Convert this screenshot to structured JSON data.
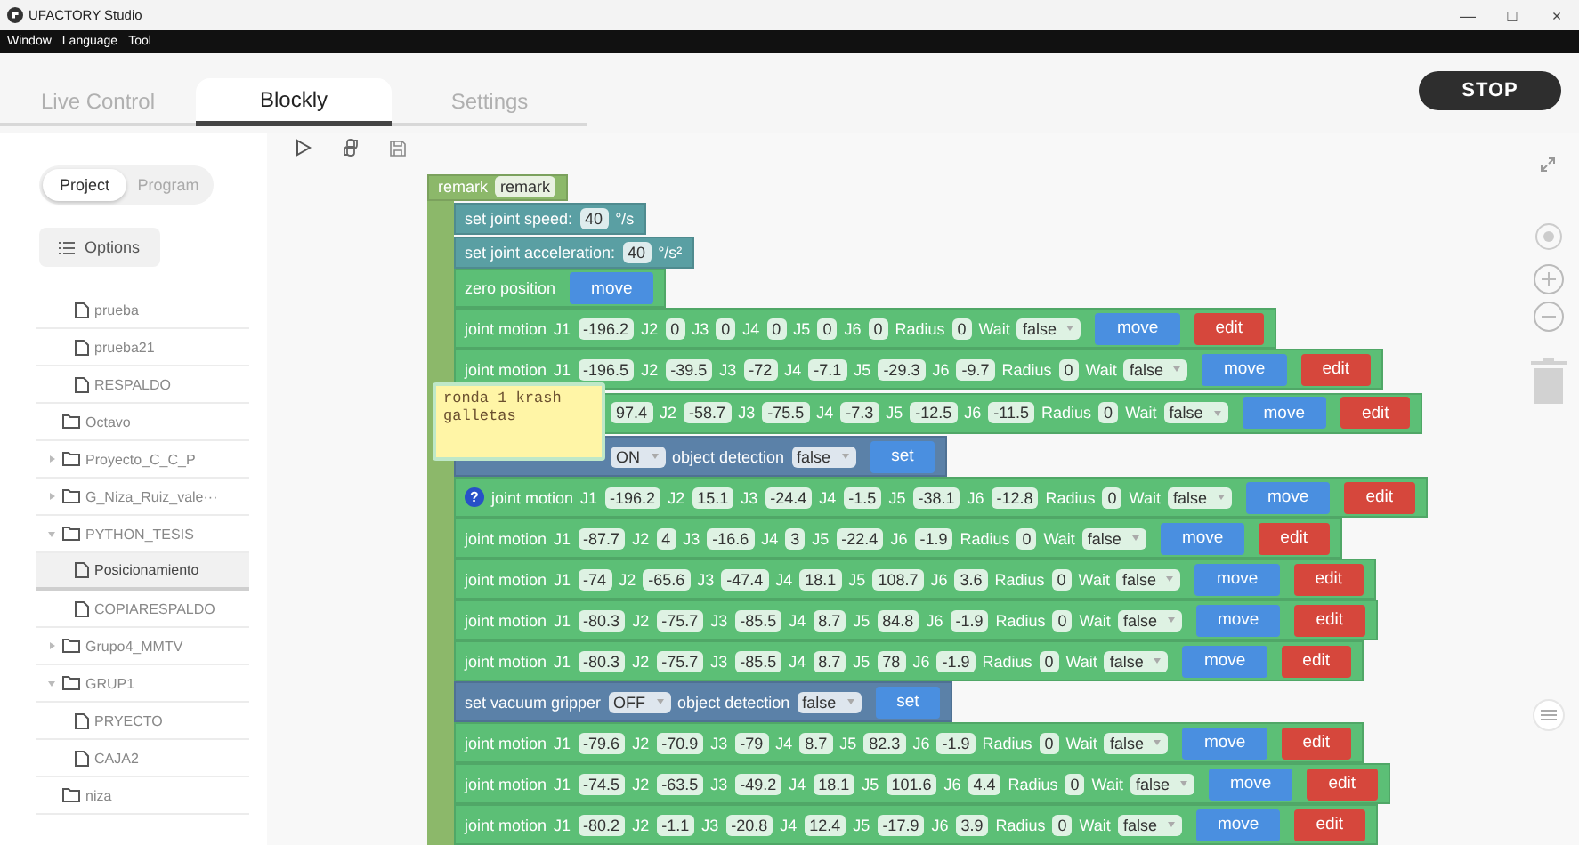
{
  "window": {
    "title": "UFACTORY Studio",
    "controls": [
      "—",
      "□",
      "×"
    ]
  },
  "menu": [
    "Window",
    "Language",
    "Tool"
  ],
  "tabs": [
    {
      "label": "Live Control",
      "selected": false
    },
    {
      "label": "Blockly",
      "selected": true
    },
    {
      "label": "Settings",
      "selected": false
    }
  ],
  "stop_button": "STOP",
  "sidebar": {
    "toggle": [
      {
        "label": "Project",
        "selected": true
      },
      {
        "label": "Program",
        "selected": false
      }
    ],
    "options_button": "Options",
    "tree": [
      {
        "children": [
          {
            "kind": "file",
            "label": "prueba",
            "selected": false
          },
          {
            "kind": "file",
            "label": "prueba21",
            "selected": false
          },
          {
            "kind": "file",
            "label": "RESPALDO",
            "selected": false
          }
        ]
      },
      {
        "kind": "empty-folder",
        "label": "Octavo",
        "selected": false
      },
      {
        "kind": "folder",
        "label": "Proyecto_C_C_P",
        "expanded": false,
        "selected": false
      },
      {
        "kind": "folder",
        "label": "G_Niza_Ruiz_vale···",
        "expanded": false,
        "selected": false
      },
      {
        "kind": "folder",
        "label": "PYTHON_TESIS",
        "expanded": true,
        "selected": false,
        "children": [
          {
            "kind": "file",
            "label": "Posicionamiento",
            "selected": true
          },
          {
            "kind": "file",
            "label": "COPIARESPALDO",
            "selected": false
          }
        ]
      },
      {
        "kind": "folder",
        "label": "Grupo4_MMTV",
        "expanded": false,
        "selected": false
      },
      {
        "kind": "folder",
        "label": "GRUP1",
        "expanded": true,
        "selected": false,
        "children": [
          {
            "kind": "file",
            "label": "PRYECTO",
            "selected": false
          },
          {
            "kind": "file",
            "label": "CAJA2",
            "selected": false
          }
        ]
      },
      {
        "kind": "empty-folder",
        "label": "niza",
        "selected": false
      }
    ]
  },
  "workspace": {
    "comment": "ronda 1 krash\ngalletas",
    "blocks": [
      {
        "kind": "remark",
        "label": "remark",
        "params": [
          {
            "value": "remark"
          }
        ],
        "children": [
          {
            "kind": "speed",
            "label": "set joint speed:",
            "params": [
              {
                "value": "40",
                "unit": "°/s"
              }
            ]
          },
          {
            "kind": "speed",
            "label": "set joint acceleration:",
            "params": [
              {
                "value": "40",
                "unit": "°/s²"
              }
            ]
          },
          {
            "kind": "zero",
            "label": "zero position",
            "actions": [
              {
                "text": "move",
                "color": "#4a8fe0"
              }
            ]
          },
          {
            "kind": "joint",
            "label": "joint motion",
            "params": [
              {
                "name": "J1",
                "value": "-196.2"
              },
              {
                "name": "J2",
                "value": "0"
              },
              {
                "name": "J3",
                "value": "0"
              },
              {
                "name": "J4",
                "value": "0"
              },
              {
                "name": "J5",
                "value": "0"
              },
              {
                "name": "J6",
                "value": "0"
              },
              {
                "name": "Radius",
                "value": "0"
              },
              {
                "name": "Wait",
                "dropdown": "false"
              }
            ],
            "actions": [
              {
                "text": "move",
                "color": "#4a8fe0"
              },
              {
                "text": "edit",
                "color": "#d6473c"
              }
            ]
          },
          {
            "kind": "joint",
            "label": "joint motion",
            "params": [
              {
                "name": "J1",
                "value": "-196.5"
              },
              {
                "name": "J2",
                "value": "-39.5"
              },
              {
                "name": "J3",
                "value": "-72"
              },
              {
                "name": "J4",
                "value": "-7.1"
              },
              {
                "name": "J5",
                "value": "-29.3"
              },
              {
                "name": "J6",
                "value": "-9.7"
              },
              {
                "name": "Radius",
                "value": "0"
              },
              {
                "name": "Wait",
                "dropdown": "false"
              }
            ],
            "actions": [
              {
                "text": "move",
                "color": "#4a8fe0"
              },
              {
                "text": "edit",
                "color": "#d6473c"
              }
            ]
          },
          {
            "kind": "joint",
            "params": [
              {
                "value": "97.4"
              },
              {
                "name": "J2",
                "value": "-58.7"
              },
              {
                "name": "J3",
                "value": "-75.5"
              },
              {
                "name": "J4",
                "value": "-7.3"
              },
              {
                "name": "J5",
                "value": "-12.5"
              },
              {
                "name": "J6",
                "value": "-11.5"
              },
              {
                "name": "Radius",
                "value": "0"
              },
              {
                "name": "Wait",
                "dropdown": "false"
              }
            ],
            "actions": [
              {
                "text": "move",
                "color": "#4a8fe0"
              },
              {
                "text": "edit",
                "color": "#d6473c"
              }
            ]
          },
          {
            "kind": "gripper",
            "params": [
              {
                "dropdown": "ON"
              },
              {
                "name": "object detection",
                "dropdown": "false"
              }
            ],
            "actions": [
              {
                "text": "set",
                "color": "#4a8fe0"
              }
            ]
          },
          {
            "kind": "joint",
            "help": "?",
            "label": "joint motion",
            "params": [
              {
                "name": "J1",
                "value": "-196.2"
              },
              {
                "name": "J2",
                "value": "15.1"
              },
              {
                "name": "J3",
                "value": "-24.4"
              },
              {
                "name": "J4",
                "value": "-1.5"
              },
              {
                "name": "J5",
                "value": "-38.1"
              },
              {
                "name": "J6",
                "value": "-12.8"
              },
              {
                "name": "Radius",
                "value": "0"
              },
              {
                "name": "Wait",
                "dropdown": "false"
              }
            ],
            "actions": [
              {
                "text": "move",
                "color": "#4a8fe0"
              },
              {
                "text": "edit",
                "color": "#d6473c"
              }
            ]
          },
          {
            "kind": "joint",
            "label": "joint motion",
            "params": [
              {
                "name": "J1",
                "value": "-87.7"
              },
              {
                "name": "J2",
                "value": "4"
              },
              {
                "name": "J3",
                "value": "-16.6"
              },
              {
                "name": "J4",
                "value": "3"
              },
              {
                "name": "J5",
                "value": "-22.4"
              },
              {
                "name": "J6",
                "value": "-1.9"
              },
              {
                "name": "Radius",
                "value": "0"
              },
              {
                "name": "Wait",
                "dropdown": "false"
              }
            ],
            "actions": [
              {
                "text": "move",
                "color": "#4a8fe0"
              },
              {
                "text": "edit",
                "color": "#d6473c"
              }
            ]
          },
          {
            "kind": "joint",
            "label": "joint motion",
            "params": [
              {
                "name": "J1",
                "value": "-74"
              },
              {
                "name": "J2",
                "value": "-65.6"
              },
              {
                "name": "J3",
                "value": "-47.4"
              },
              {
                "name": "J4",
                "value": "18.1"
              },
              {
                "name": "J5",
                "value": "108.7"
              },
              {
                "name": "J6",
                "value": "3.6"
              },
              {
                "name": "Radius",
                "value": "0"
              },
              {
                "name": "Wait",
                "dropdown": "false"
              }
            ],
            "actions": [
              {
                "text": "move",
                "color": "#4a8fe0"
              },
              {
                "text": "edit",
                "color": "#d6473c"
              }
            ]
          },
          {
            "kind": "joint",
            "label": "joint motion",
            "params": [
              {
                "name": "J1",
                "value": "-80.3"
              },
              {
                "name": "J2",
                "value": "-75.7"
              },
              {
                "name": "J3",
                "value": "-85.5"
              },
              {
                "name": "J4",
                "value": "8.7"
              },
              {
                "name": "J5",
                "value": "84.8"
              },
              {
                "name": "J6",
                "value": "-1.9"
              },
              {
                "name": "Radius",
                "value": "0"
              },
              {
                "name": "Wait",
                "dropdown": "false"
              }
            ],
            "actions": [
              {
                "text": "move",
                "color": "#4a8fe0"
              },
              {
                "text": "edit",
                "color": "#d6473c"
              }
            ]
          },
          {
            "kind": "joint",
            "label": "joint motion",
            "params": [
              {
                "name": "J1",
                "value": "-80.3"
              },
              {
                "name": "J2",
                "value": "-75.7"
              },
              {
                "name": "J3",
                "value": "-85.5"
              },
              {
                "name": "J4",
                "value": "8.7"
              },
              {
                "name": "J5",
                "value": "78"
              },
              {
                "name": "J6",
                "value": "-1.9"
              },
              {
                "name": "Radius",
                "value": "0"
              },
              {
                "name": "Wait",
                "dropdown": "false"
              }
            ],
            "actions": [
              {
                "text": "move",
                "color": "#4a8fe0"
              },
              {
                "text": "edit",
                "color": "#d6473c"
              }
            ]
          },
          {
            "kind": "gripper",
            "label": "set vacuum gripper",
            "params": [
              {
                "dropdown": "OFF"
              },
              {
                "name": "object detection",
                "dropdown": "false"
              }
            ],
            "actions": [
              {
                "text": "set",
                "color": "#4a8fe0"
              }
            ]
          },
          {
            "kind": "joint",
            "label": "joint motion",
            "params": [
              {
                "name": "J1",
                "value": "-79.6"
              },
              {
                "name": "J2",
                "value": "-70.9"
              },
              {
                "name": "J3",
                "value": "-79"
              },
              {
                "name": "J4",
                "value": "8.7"
              },
              {
                "name": "J5",
                "value": "82.3"
              },
              {
                "name": "J6",
                "value": "-1.9"
              },
              {
                "name": "Radius",
                "value": "0"
              },
              {
                "name": "Wait",
                "dropdown": "false"
              }
            ],
            "actions": [
              {
                "text": "move",
                "color": "#4a8fe0"
              },
              {
                "text": "edit",
                "color": "#d6473c"
              }
            ]
          },
          {
            "kind": "joint",
            "label": "joint motion",
            "params": [
              {
                "name": "J1",
                "value": "-74.5"
              },
              {
                "name": "J2",
                "value": "-63.5"
              },
              {
                "name": "J3",
                "value": "-49.2"
              },
              {
                "name": "J4",
                "value": "18.1"
              },
              {
                "name": "J5",
                "value": "101.6"
              },
              {
                "name": "J6",
                "value": "4.4"
              },
              {
                "name": "Radius",
                "value": "0"
              },
              {
                "name": "Wait",
                "dropdown": "false"
              }
            ],
            "actions": [
              {
                "text": "move",
                "color": "#4a8fe0"
              },
              {
                "text": "edit",
                "color": "#d6473c"
              }
            ]
          },
          {
            "kind": "joint",
            "label": "joint motion",
            "params": [
              {
                "name": "J1",
                "value": "-80.2"
              },
              {
                "name": "J2",
                "value": "-1.1"
              },
              {
                "name": "J3",
                "value": "-20.8"
              },
              {
                "name": "J4",
                "value": "12.4"
              },
              {
                "name": "J5",
                "value": "-17.9"
              },
              {
                "name": "J6",
                "value": "3.9"
              },
              {
                "name": "Radius",
                "value": "0"
              },
              {
                "name": "Wait",
                "dropdown": "false"
              }
            ],
            "actions": [
              {
                "text": "move",
                "color": "#4a8fe0"
              },
              {
                "text": "edit",
                "color": "#d6473c"
              }
            ]
          }
        ]
      }
    ]
  }
}
